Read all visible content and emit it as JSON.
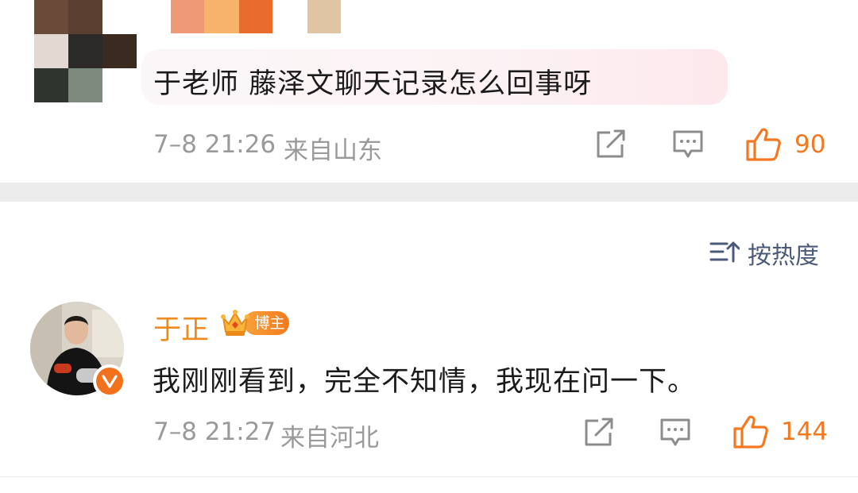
{
  "comment_1": {
    "text": "于老师 藤泽文聊天记录怎么回事呀",
    "timestamp": "7–8 21:26",
    "location": "来自山东",
    "like_count": "90",
    "share_icon": "share-icon",
    "reply_icon": "comment-icon",
    "like_icon": "thumbs-up-icon"
  },
  "sort": {
    "label": "按热度",
    "icon": "sort-icon"
  },
  "comment_2": {
    "username": "于正",
    "badge_label": "博主",
    "text": "我刚刚看到，完全不知情，我现在问一下。",
    "timestamp": "7–8 21:27",
    "location": "来自河北",
    "like_count": "144",
    "share_icon": "share-icon",
    "reply_icon": "comment-icon",
    "like_icon": "thumbs-up-icon"
  },
  "colors": {
    "accent_orange": "#f08a1c",
    "like_icon": "#f4781f",
    "meta_gray": "#9a9a9a",
    "sort_blue": "#4c5a79",
    "section_band": "#ececec"
  }
}
